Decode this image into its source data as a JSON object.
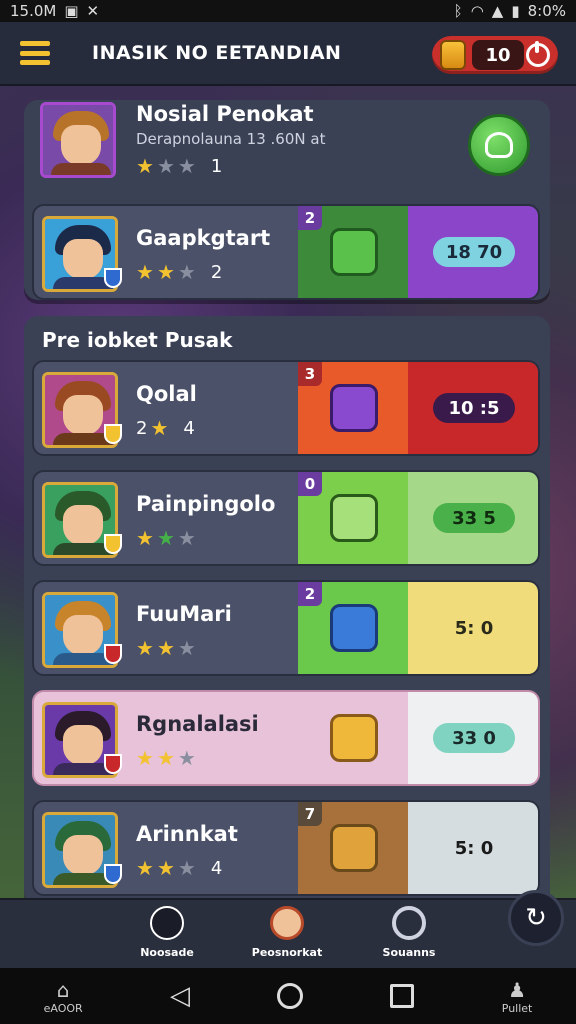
{
  "status": {
    "time": "15.0M",
    "battery": "8:0%"
  },
  "header": {
    "title": "INASIK NO EETANDIAN",
    "coins": "10"
  },
  "featured": {
    "name": "Nosial Penokat",
    "subtitle": "Derapnolauna 13 .60N at",
    "stars": 1,
    "count": "1"
  },
  "top_card": {
    "name": "Gaapkgtart",
    "stars": 2,
    "count": "2",
    "level": "2",
    "time": "18 70"
  },
  "section": {
    "title": "Pre iobket Pusak"
  },
  "cards": [
    {
      "name": "Qolal",
      "stars_label": "2",
      "count": "4",
      "level": "3",
      "time": "10 :5"
    },
    {
      "name": "Painpingolo",
      "level": "0",
      "time": "33  5"
    },
    {
      "name": "FuuMari",
      "level": "2",
      "time": "5: 0"
    },
    {
      "name": "Rgnalalasi",
      "time": "33  0"
    },
    {
      "name": "Arinnkat",
      "count": "4",
      "level": "7",
      "time": "5: 0"
    }
  ],
  "bottom_nav": [
    {
      "label": "Noosade"
    },
    {
      "label": "Peosnorkat"
    },
    {
      "label": "Souanns"
    }
  ],
  "system_nav": {
    "left_label": "eAOOR",
    "right_label": "Pullet"
  },
  "colors": {
    "accent": "#f3c230",
    "red": "#c9302c",
    "green": "#2e9a2e",
    "purple": "#6a3ca0"
  }
}
